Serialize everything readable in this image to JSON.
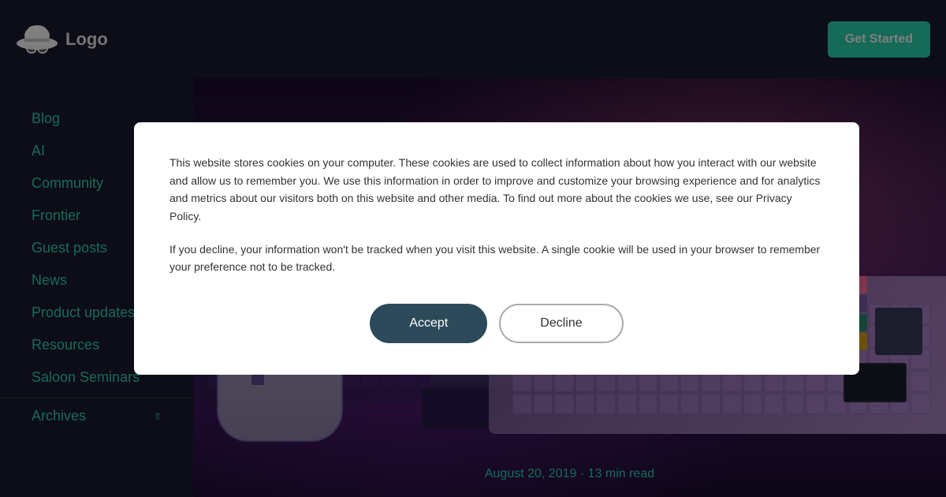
{
  "header": {
    "logo_alt": "Logo",
    "get_started_label": "Get Started"
  },
  "sidebar": {
    "items": [
      {
        "label": "Blog",
        "id": "blog"
      },
      {
        "label": "AI",
        "id": "ai"
      },
      {
        "label": "Community",
        "id": "community"
      },
      {
        "label": "Frontier",
        "id": "frontier"
      },
      {
        "label": "Guest posts",
        "id": "guest-posts"
      },
      {
        "label": "News",
        "id": "news"
      },
      {
        "label": "Product updates",
        "id": "product-updates"
      },
      {
        "label": "Resources",
        "id": "resources"
      },
      {
        "label": "Saloon Seminars",
        "id": "saloon-seminars"
      }
    ],
    "archives_label": "Archives",
    "archives_expanded": true
  },
  "hero": {
    "date": "August 20, 2019",
    "read_time": "13 min read",
    "date_separator": "·"
  },
  "cookie_modal": {
    "text1": "This website stores cookies on your computer. These cookies are used to collect information about how you interact with our website and allow us to remember you. We use this information in order to improve and customize your browsing experience and for analytics and metrics about our visitors both on this website and other media. To find out more about the cookies we use, see our Privacy Policy.",
    "text2": "If you decline, your information won't be tracked when you visit this website. A single cookie will be used in your browser to remember your preference not to be tracked.",
    "accept_label": "Accept",
    "decline_label": "Decline"
  }
}
